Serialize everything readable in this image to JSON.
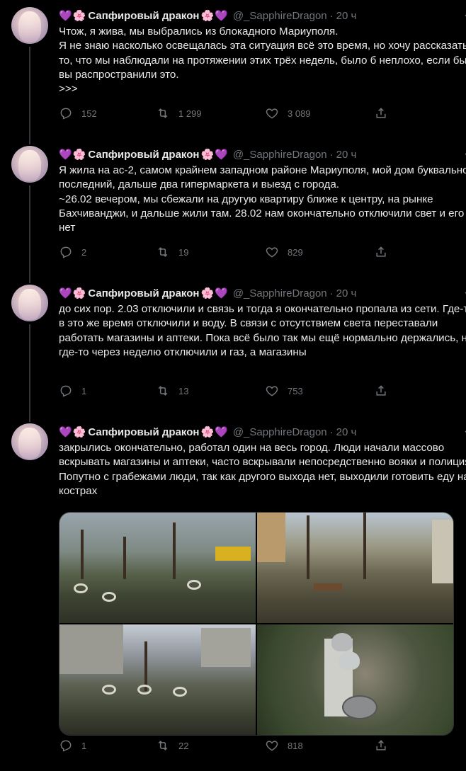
{
  "tweets": [
    {
      "display_name": "Сапфировый дракон",
      "handle": "@_SapphireDragon",
      "time": "20 ч",
      "text": "Чтож, я жива, мы выбрались из блокадного Мариуполя.\nЯ не знаю насколько освещалась эта ситуация всё это время, но хочу рассказать то, что мы наблюдали на протяжении этих трёх недель, было б неплохо, если бы вы распространили это.\n>>>",
      "replies": "152",
      "retweets": "1 299",
      "likes": "3 089"
    },
    {
      "display_name": "Сапфировый дракон",
      "handle": "@_SapphireDragon",
      "time": "20 ч",
      "text": "Я жила на ас-2, самом крайнем западном районе Мариуполя, мой дом буквально последний, дальше два гипермаркета и выезд с города.\n~26.02 вечером, мы сбежали на другую квартиру ближе к центру, на рынке Бахчиванджи, и дальше жили там. 28.02 нам окончательно отключили свет и его нет",
      "replies": "2",
      "retweets": "19",
      "likes": "829"
    },
    {
      "display_name": "Сапфировый дракон",
      "handle": "@_SapphireDragon",
      "time": "20 ч",
      "text": "до сих пор. 2.03 отключили и связь и тогда я окончательно пропала из сети. Где-то в это же время отключили и воду. В связи с отсутствием света переставали работать магазины и аптеки. Пока всё было так мы ещё нормально держались, но где-то через неделю отключили и газ, а магазины",
      "replies": "1",
      "retweets": "13",
      "likes": "753"
    },
    {
      "display_name": "Сапфировый дракон",
      "handle": "@_SapphireDragon",
      "time": "20 ч",
      "text": "закрылись окончательно, работал один на весь город. Люди начали массово вскрывать магазины и аптеки, часто вскрывали непосредственно вояки и полиция. Попутно с грабежами люди, так как другого выхода нет, выходили готовить еду на кострах",
      "replies": "1",
      "retweets": "22",
      "likes": "818"
    }
  ],
  "emoji": {
    "heart": "💜",
    "flower": "🌸"
  },
  "icons": {
    "more": "more-icon",
    "reply": "reply-icon",
    "retweet": "retweet-icon",
    "like": "heart-icon",
    "share": "share-icon"
  },
  "colors": {
    "background": "#000000",
    "text": "#e7e9ea",
    "muted": "#71767b",
    "border": "#2f3336"
  }
}
